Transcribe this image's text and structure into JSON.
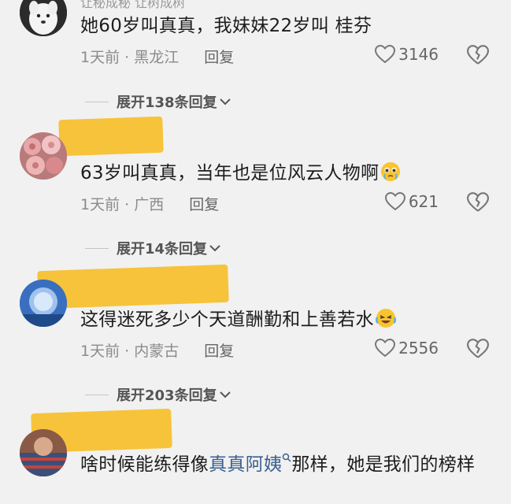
{
  "top_strip_text": "让秘成秘  让树成树",
  "comments": [
    {
      "text": "她60岁叫真真，我妹妹22岁叫 桂芬",
      "time": "1天前",
      "location": "黑龙江",
      "reply_label": "回复",
      "likes": "3146",
      "expand_label": "展开138条回复"
    },
    {
      "text": "63岁叫真真，当年也是位风云人物啊",
      "time": "1天前",
      "location": "广西",
      "reply_label": "回复",
      "likes": "621",
      "expand_label": "展开14条回复"
    },
    {
      "text": "这得迷死多少个天道酬勤和上善若水",
      "time": "1天前",
      "location": "内蒙古",
      "reply_label": "回复",
      "likes": "2556",
      "expand_label": "展开203条回复"
    },
    {
      "text_before": "啥时候能练得像",
      "link_text": "真真阿姨",
      "text_after": "那样，她是我们的榜样"
    }
  ],
  "colors": {
    "redaction": "#f6c33b",
    "link": "#3a5f8f",
    "background": "#f1f1f1"
  }
}
